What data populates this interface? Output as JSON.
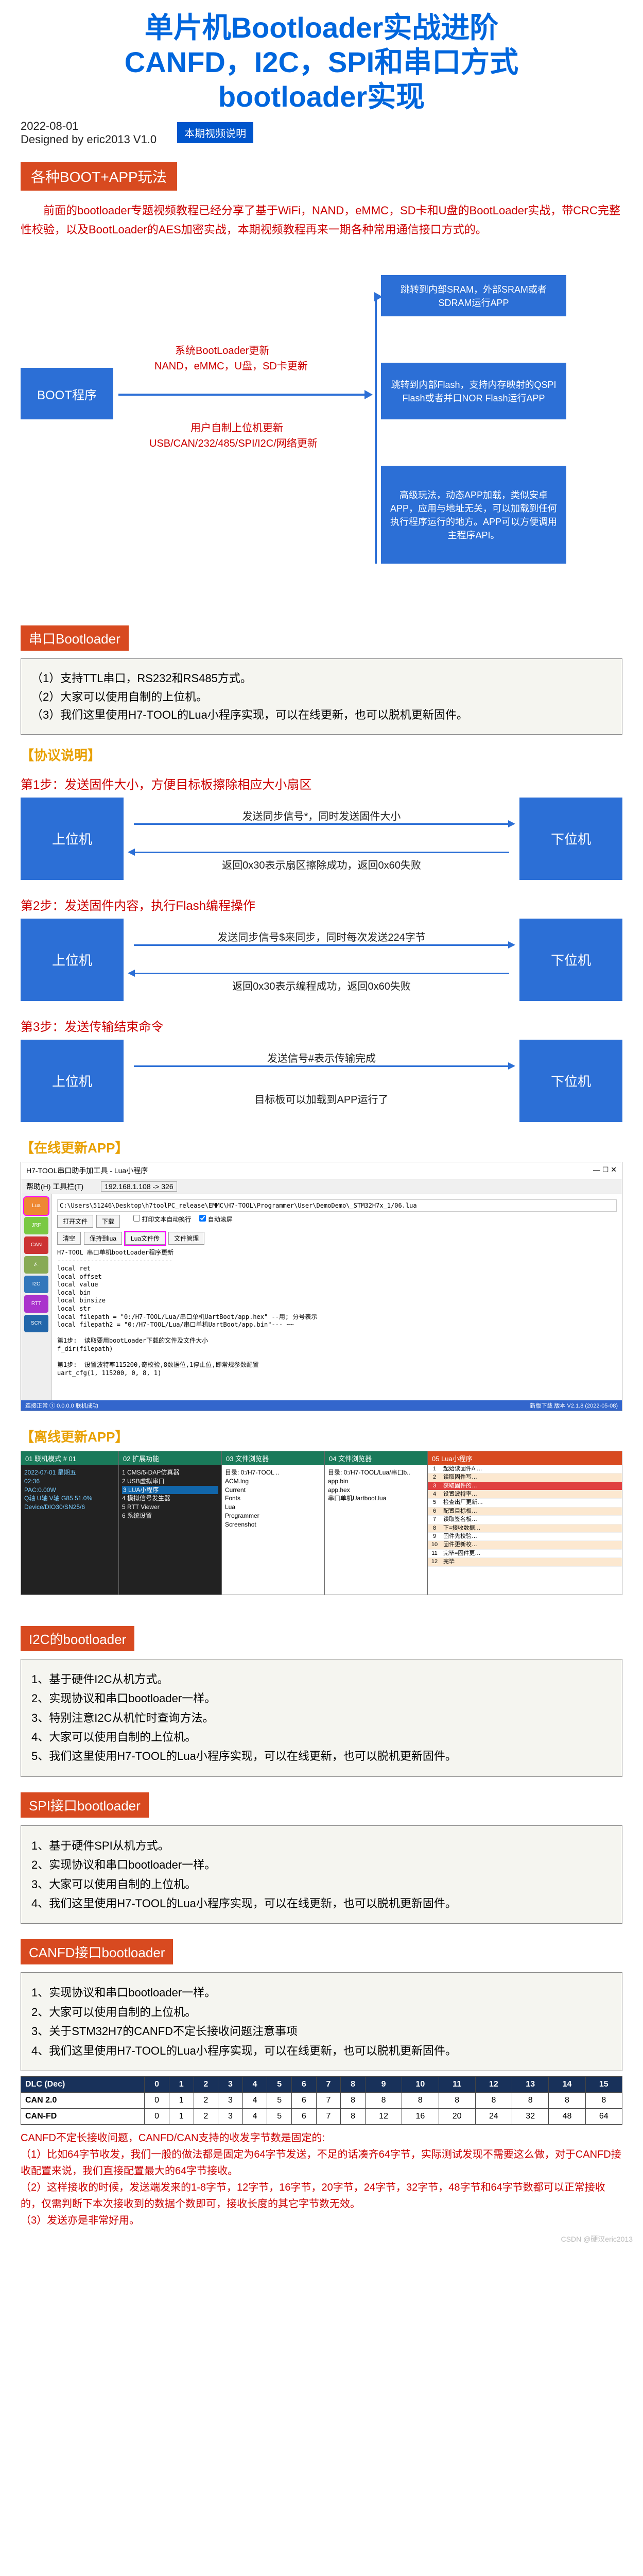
{
  "title_l1": "单片机Bootloader实战进阶",
  "title_l2": "CANFD，I2C，SPI和串口方式",
  "title_l3": "bootloader实现",
  "meta_date": "2022-08-01",
  "meta_author": "Designed by eric2013 V1.0",
  "badge_video": "本期视频说明",
  "sec1_title": "各种BOOT+APP玩法",
  "intro": "前面的bootloader专题视频教程已经分享了基于WiFi，NAND，eMMC，SD卡和U盘的BootLoader实战，带CRC完整性校验，以及BootLoader的AES加密实战，本期视频教程再来一期各种常用通信接口方式的。",
  "flow": {
    "boot": "BOOT程序",
    "sys_update": "系统BootLoader更新",
    "sys_media": "NAND，eMMC，U盘，SD卡更新",
    "user_update": "用户自制上位机更新",
    "user_media": "USB/CAN/232/485/SPI/I2C/网络更新",
    "b1": "跳转到内部SRAM，外部SRAM或者SDRAM运行APP",
    "b2": "跳转到内部Flash，支持内存映射的QSPI Flash或者并口NOR Flash运行APP",
    "b3": "高级玩法，动态APP加载，类似安卓APP，应用与地址无关，可以加载到任何执行程序运行的地方。APP可以方便调用主程序API。"
  },
  "uart_title": "串口Bootloader",
  "uart_points": [
    "（1）支持TTL串口，RS232和RS485方式。",
    "（2）大家可以使用自制的上位机。",
    "（3）我们这里使用H7-TOOL的Lua小程序实现，可以在线更新，也可以脱机更新固件。"
  ],
  "proto_title": "【协议说明】",
  "step1": "第1步：发送固件大小，方便目标板擦除相应大小扇区",
  "step1_a": "发送同步信号*，同时发送固件大小",
  "step1_b": "返回0x30表示扇区擦除成功，返回0x60失败",
  "step2": "第2步：发送固件内容，执行Flash编程操作",
  "step2_a": "发送同步信号$来同步，同时每次发送224字节",
  "step2_b": "返回0x30表示编程成功，返回0x60失败",
  "step3": "第3步：发送传输结束命令",
  "step3_a": "发送信号#表示传输完成",
  "step3_b": "目标板可以加载到APP运行了",
  "host": "上位机",
  "device": "下位机",
  "online_title": "【在线更新APP】",
  "ss": {
    "window_title": "H7-TOOL串口助手加工具 - Lua小程序",
    "menu": "帮助(H)  工具栏(T)",
    "ip": "192.168.1.108 -> 326",
    "path1": "C:\\Users\\51246\\Desktop\\h7toolPC_release\\EMMC\\H7-TOOL\\Programmer\\User\\DemoDemo\\_STM32H7x_1/06.lua",
    "btns_row1": [
      "打开文件",
      "下载"
    ],
    "checks": [
      "打印文本自动换行",
      "自动滚屏"
    ],
    "btns_row2": [
      "清空",
      "保持到lua",
      "Lua文件传",
      "文件管理"
    ],
    "log_header": "H7-TOOL 串口单机bootLoader程序更新\n-------------------------------",
    "log": "local ret\nlocal offset\nlocal value\nlocal bin\nlocal binsize\nlocal str\nlocal filepath = \"0:/H7-TOOL/Lua/串口单机UartBoot/app.hex\" --用; 分号表示\nlocal filepath2 = \"0:/H7-TOOL/Lua/串口单机UartBoot/app.bin\"--- ~~\n\n第1步:  读取要用bootLoader下载的文件及文件大小\nf_dir(filepath)\n\n第1步:  设置波特率115200,奇校验,8数据位,1停止位,即常规参数配置\nuart_cfg(1, 115200, 0, 8, 1)",
    "status_l": "连接正常 ① 0.0.0.0 联机成功",
    "status_r": "新版下载  版本 V2.1.8 (2022-05-08)"
  },
  "offline_title": "【离线更新APP】",
  "off": {
    "c1_hdr": "01                联机模式   # 01",
    "c1_body": "2022-07-01   星期五\n02:36\nPAC:0.00W\nQ轴 U轴 V轴 G85 51.0%\nDevice/DIO30/SN25/6",
    "c2_hdr": "02                    扩展功能",
    "c2_items": [
      "1 CMS/5-DAP仿真器",
      "2 USB虚拟串口",
      "3 LUA小程序",
      "4 模拟信号发生器",
      "5 RTT Viewer",
      "6 系统设置"
    ],
    "c3_hdr": "03                    文件浏览器",
    "c3_body": "目录: 0:/H7-TOOL ..\nACM.log\nCurrent\nFonts\nLua\nProgrammer\nScreenshot",
    "c4_hdr": "04                    文件浏览器",
    "c4_body": "目录: 0:/H7-TOOL/Lua/串口b..\napp.bin\napp.hex\n串口单机Uartboot.lua",
    "c5_hdr": "05                    Lua小程序",
    "lua_rows": [
      "起始读固件A …",
      "读取固件写…",
      "获取固件的…",
      "设置波特率…",
      "检查出厂更新…",
      "配置目标板…",
      "读取签名板…",
      "下=接收数据…",
      "固件先校验…",
      "固件更新校…",
      "完毕=固件更…",
      "完毕"
    ]
  },
  "i2c_title": "I2C的bootloader",
  "i2c_points": [
    "1、基于硬件I2C从机方式。",
    "2、实现协议和串口bootloader一样。",
    "3、特别注意I2C从机忙时查询方法。",
    "4、大家可以使用自制的上位机。",
    "5、我们这里使用H7-TOOL的Lua小程序实现，可以在线更新，也可以脱机更新固件。"
  ],
  "spi_title": "SPI接口bootloader",
  "spi_points": [
    "1、基于硬件SPI从机方式。",
    "2、实现协议和串口bootloader一样。",
    "3、大家可以使用自制的上位机。",
    "4、我们这里使用H7-TOOL的Lua小程序实现，可以在线更新，也可以脱机更新固件。"
  ],
  "canfd_title": "CANFD接口bootloader",
  "canfd_points": [
    "1、实现协议和串口bootloader一样。",
    "2、大家可以使用自制的上位机。",
    "3、关于STM32H7的CANFD不定长接收问题注意事项",
    "4、我们这里使用H7-TOOL的Lua小程序实现，可以在线更新，也可以脱机更新固件。"
  ],
  "dlc": {
    "hdr": "DLC (Dec)",
    "cols": [
      "0",
      "1",
      "2",
      "3",
      "4",
      "5",
      "6",
      "7",
      "8",
      "9",
      "10",
      "11",
      "12",
      "13",
      "14",
      "15"
    ],
    "row1_label": "CAN 2.0",
    "row1": [
      "0",
      "1",
      "2",
      "3",
      "4",
      "5",
      "6",
      "7",
      "8",
      "8",
      "8",
      "8",
      "8",
      "8",
      "8",
      "8"
    ],
    "row2_label": "CAN-FD",
    "row2": [
      "0",
      "1",
      "2",
      "3",
      "4",
      "5",
      "6",
      "7",
      "8",
      "12",
      "16",
      "20",
      "24",
      "32",
      "48",
      "64"
    ]
  },
  "final": [
    "CANFD不定长接收问题，CANFD/CAN支持的收发字节数是固定的:",
    "（1）比如64字节收发，我们一般的做法都是固定为64字节发送，不足的话凑齐64字节，实际测试发现不需要这么做，对于CANFD接收配置来说，我们直接配置最大的64字节接收。",
    "（2）这样接收的时候，发送端发来的1-8字节，12字节，16字节，20字节，24字节，32字节，48字节和64字节数都可以正常接收的，仅需判断下本次接收到的数据个数即可，接收长度的其它字节数无效。",
    "（3）发送亦是非常好用。"
  ],
  "watermark": "CSDN @硬汉eric2013"
}
